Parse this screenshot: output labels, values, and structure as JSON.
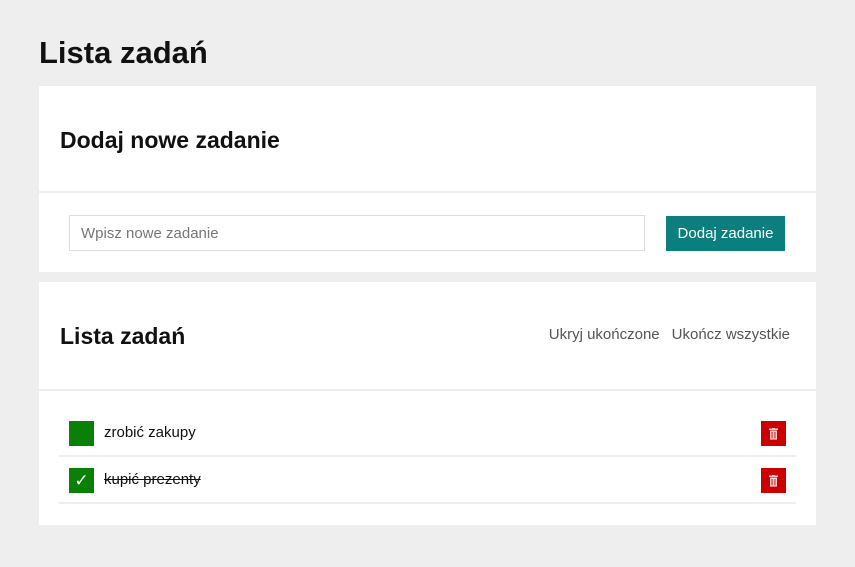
{
  "page": {
    "title": "Lista zadań"
  },
  "add_section": {
    "title": "Dodaj nowe zadanie",
    "input_placeholder": "Wpisz nowe zadanie",
    "input_value": "",
    "button_label": "Dodaj zadanie"
  },
  "list_section": {
    "title": "Lista zadań",
    "hide_completed_label": "Ukryj ukończone",
    "complete_all_label": "Ukończ wszystkie",
    "tasks": [
      {
        "text": "zrobić zakupy",
        "done": false,
        "check_glyph": ""
      },
      {
        "text": "kupić prezenty",
        "done": true,
        "check_glyph": "✓"
      }
    ]
  },
  "colors": {
    "background": "#eeeeee",
    "accent_button": "#0b7f7d",
    "checkbox": "#0a8006",
    "delete": "#cc0000"
  },
  "icons": {
    "delete": "trash-icon",
    "check": "checkmark-icon"
  }
}
